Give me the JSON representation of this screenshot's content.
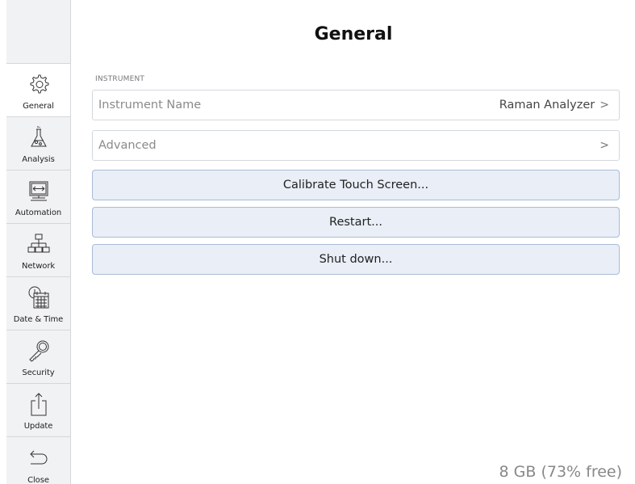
{
  "header": {
    "title": "General"
  },
  "sidebar": {
    "items": [
      {
        "label": "General",
        "icon": "gear-icon",
        "active": true
      },
      {
        "label": "Analysis",
        "icon": "flask-icon",
        "active": false
      },
      {
        "label": "Automation",
        "icon": "monitor-arrows-icon",
        "active": false
      },
      {
        "label": "Network",
        "icon": "network-icon",
        "active": false
      },
      {
        "label": "Date & Time",
        "icon": "calendar-clock-icon",
        "active": false
      },
      {
        "label": "Security",
        "icon": "key-icon",
        "active": false
      },
      {
        "label": "Update",
        "icon": "upload-icon",
        "active": false
      },
      {
        "label": "Close",
        "icon": "back-arrow-icon",
        "active": false
      }
    ]
  },
  "main": {
    "section_label": "INSTRUMENT",
    "instrument_name": {
      "label": "Instrument Name",
      "value": "Raman Analyzer",
      "chevron": ">"
    },
    "advanced": {
      "label": "Advanced",
      "chevron": ">"
    },
    "buttons": {
      "calibrate": "Calibrate Touch Screen...",
      "restart": "Restart...",
      "shutdown": "Shut down..."
    },
    "storage": "8 GB (73% free)"
  },
  "colors": {
    "sidebar_bg": "#f1f2f4",
    "button_bg": "#e9eef7",
    "button_border": "#a9bcd6"
  }
}
